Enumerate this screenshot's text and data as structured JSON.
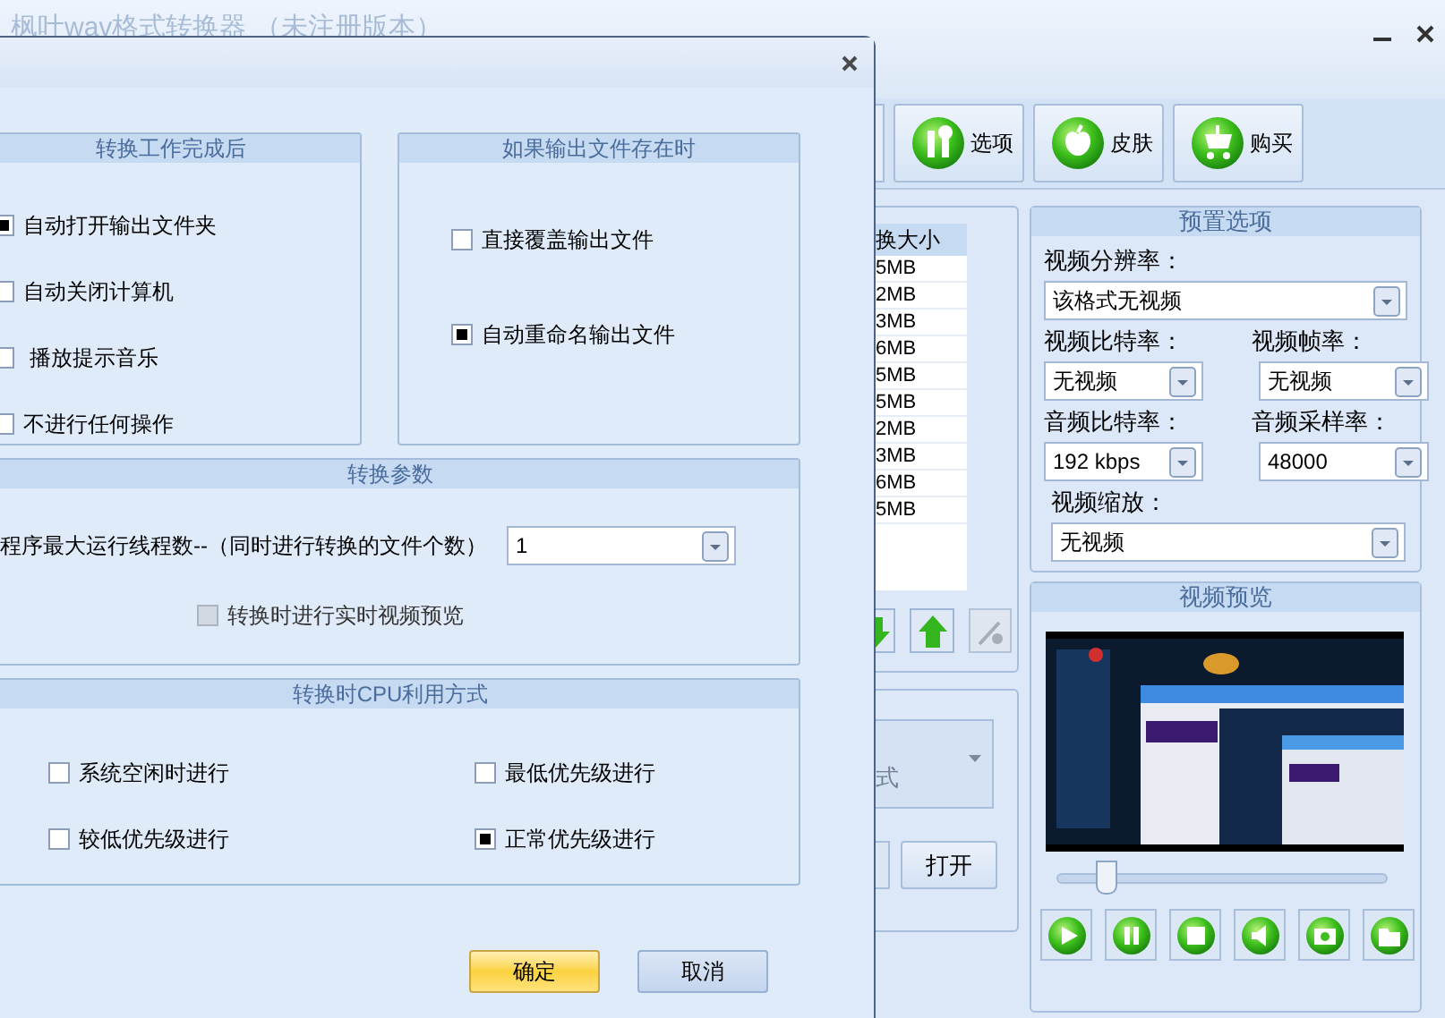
{
  "main_window": {
    "title": "枫叶wav格式转换器 （未注册版本）",
    "toolbar": [
      {
        "kind": "options",
        "label": "选项"
      },
      {
        "kind": "skin",
        "label": "皮肤"
      },
      {
        "kind": "buy",
        "label": "购买"
      }
    ],
    "file_list": {
      "column_header": "换大小",
      "rows": [
        "5MB",
        "2MB",
        "3MB",
        "6MB",
        "5MB",
        "5MB",
        "2MB",
        "3MB",
        "6MB",
        "5MB"
      ]
    },
    "format_dropdown": {
      "value": "式"
    },
    "open_button": "打开",
    "preset": {
      "title": "预置选项",
      "fields": [
        {
          "kind": "wide",
          "label": "视频分辨率：",
          "value": "该格式无视频"
        },
        {
          "kind": "half",
          "label": "视频比特率：",
          "value": "无视频"
        },
        {
          "kind": "half",
          "label": "视频帧率：",
          "value": "无视频"
        },
        {
          "kind": "half",
          "label": "音频比特率：",
          "value": "192 kbps"
        },
        {
          "kind": "half",
          "label": "音频采样率：",
          "value": "48000"
        },
        {
          "kind": "wide",
          "label": "视频缩放：",
          "value": "无视频"
        }
      ]
    },
    "preview": {
      "title": "视频预览",
      "seek": {
        "level": 0.12
      },
      "controls": [
        {
          "kind": "play"
        },
        {
          "kind": "pause"
        },
        {
          "kind": "stop"
        },
        {
          "kind": "mute"
        },
        {
          "kind": "snapshot"
        },
        {
          "kind": "folder"
        }
      ]
    }
  },
  "dialog": {
    "after_done": {
      "title": "转换工作完成后",
      "options": [
        {
          "label": "自动打开输出文件夹",
          "checked": true
        },
        {
          "label": "自动关闭计算机",
          "checked": false
        },
        {
          "label": " 播放提示音乐",
          "checked": false
        },
        {
          "label": "不进行任何操作",
          "checked": false
        }
      ]
    },
    "if_exists": {
      "title": "如果输出文件存在时",
      "options": [
        {
          "label": "直接覆盖输出文件",
          "checked": false
        },
        {
          "label": "自动重命名输出文件",
          "checked": true
        }
      ]
    },
    "params": {
      "title": "转换参数",
      "threads_label": "程序最大运行线程数--（同时进行转换的文件个数）",
      "threads_value": "1",
      "preview_option": {
        "label": "转换时进行实时视频预览",
        "checked": false,
        "disabled": true
      }
    },
    "cpu": {
      "title": "转换时CPU利用方式",
      "options": [
        {
          "label": "系统空闲时进行",
          "checked": false
        },
        {
          "label": "最低优先级进行",
          "checked": false
        },
        {
          "label": "较低优先级进行",
          "checked": false
        },
        {
          "label": "正常优先级进行",
          "checked": true
        }
      ]
    },
    "buttons": [
      {
        "label": "确定",
        "selected": true
      },
      {
        "label": "取消",
        "selected": false
      }
    ]
  }
}
